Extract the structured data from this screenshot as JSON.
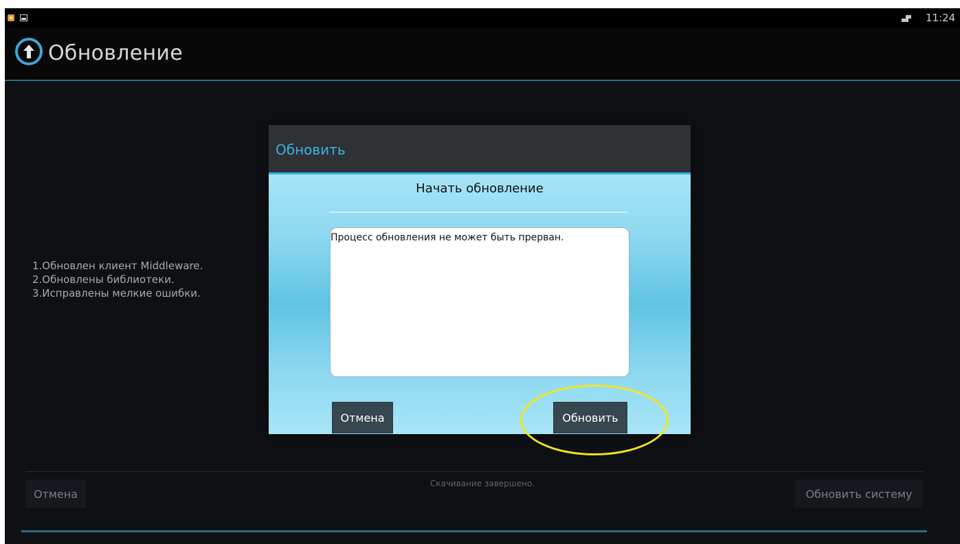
{
  "status_bar": {
    "time": "11:24",
    "icons": [
      "app-notification-icon",
      "picture-icon",
      "network-icon"
    ]
  },
  "action_bar": {
    "title": "Обновление",
    "icon": "update-arrow-icon"
  },
  "main": {
    "changelog": [
      "1.Обновлен клиент Middleware.",
      "2.Обновлены библиотеки.",
      "3.Исправлены мелкие ошибки."
    ],
    "status_text": "Скачивание завершено.",
    "cancel_label": "Отмена",
    "update_system_label": "Обновить систему"
  },
  "dialog": {
    "title": "Обновить",
    "subtitle": "Начать обновление",
    "message": "Процесс обновления не может быть прерван.",
    "cancel_label": "Отмена",
    "update_label": "Обновить"
  },
  "colors": {
    "accent": "#38b2e0",
    "highlight": "#f3e51d",
    "dialog_button": "#37474f"
  }
}
